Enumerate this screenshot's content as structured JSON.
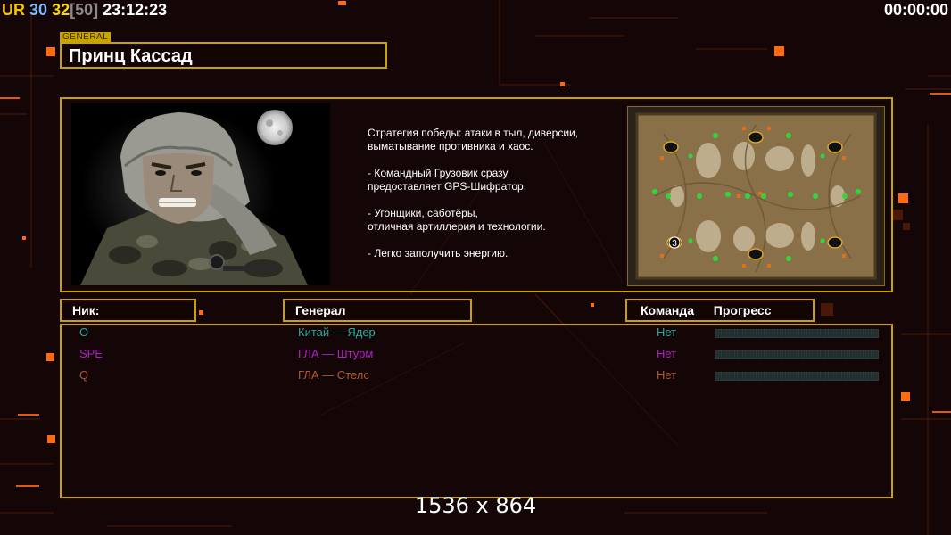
{
  "hud": {
    "ur": "UR",
    "val1": "30",
    "val2": "32",
    "bracket": "[50]",
    "clock": "23:12:23",
    "timer": "00:00:00"
  },
  "general": {
    "tag": "GENERAL",
    "name": "Принц Кассад"
  },
  "description": [
    "Стратегия победы: атаки в тыл, диверсии,\n выматывание противника и хаос.",
    "- Командный Грузовик сразу\nпредоставляет GPS-Шифратор.",
    "- Угонщики, саботёры,\nотличная артиллерия и технологии.",
    "- Легко заполучить энергию."
  ],
  "table": {
    "nick_header": "Ник:",
    "general_header": "Генерал",
    "team_header": "Команда",
    "progress_header": "Прогресс"
  },
  "players": [
    {
      "nick": "O",
      "general": "Китай — Ядер",
      "team": "Нет",
      "color": "#2aa8a0",
      "progress": 0
    },
    {
      "nick": "SPE",
      "general": "ГЛА — Штурм",
      "team": "Нет",
      "color": "#b020c8",
      "progress": 0
    },
    {
      "nick": "Q",
      "general": "ГЛА — Стелс",
      "team": "Нет",
      "color": "#b05a2a",
      "progress": 0
    }
  ],
  "map": {
    "slot_number": "3"
  },
  "resolution_label": "1536 x 864",
  "colors": {
    "accent": "#caa200",
    "ur": "#f5c400",
    "val1": "#7ab8ff",
    "val2": "#ffd700",
    "bracket": "#8a8a8a"
  }
}
